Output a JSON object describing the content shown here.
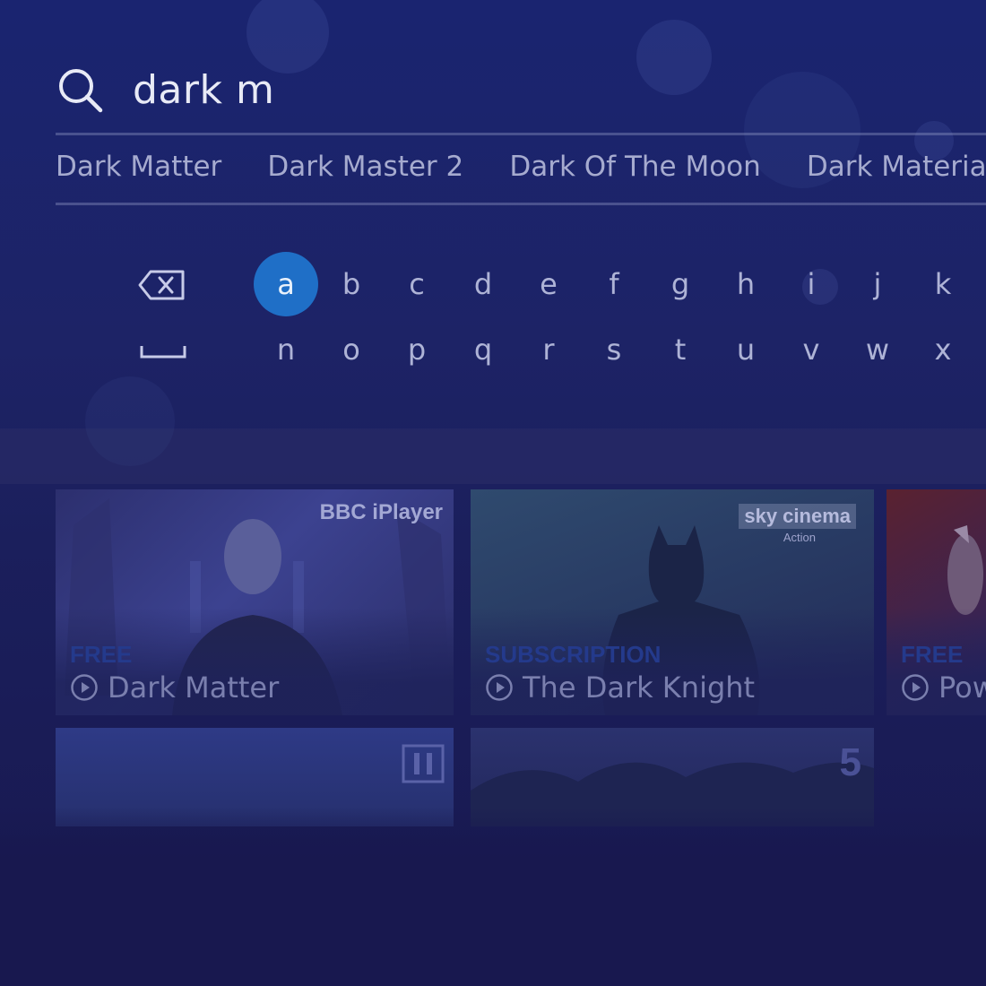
{
  "search": {
    "query": "dark m"
  },
  "suggestions": [
    "Dark Matter",
    "Dark Master 2",
    "Dark Of The Moon",
    "Dark Materia"
  ],
  "keyboard": {
    "row1": [
      "a",
      "b",
      "c",
      "d",
      "e",
      "f",
      "g",
      "h",
      "i",
      "j",
      "k"
    ],
    "row2": [
      "n",
      "o",
      "p",
      "q",
      "r",
      "s",
      "t",
      "u",
      "v",
      "w",
      "x"
    ],
    "selected": "a"
  },
  "results": [
    {
      "access": "FREE",
      "title": "Dark Matter",
      "provider": "BBC iPlayer",
      "accent": "#3a4290"
    },
    {
      "access": "SUBSCRIPTION",
      "title": "The Dark Knight",
      "provider_main": "sky cinema",
      "provider_sub": "Action",
      "accent": "#2f4a6e"
    },
    {
      "access": "FREE",
      "title": "Pow",
      "accent": "#5a2230"
    }
  ],
  "colors": {
    "selected_key": "#1f6fc7",
    "access_label": "#243a8c"
  }
}
